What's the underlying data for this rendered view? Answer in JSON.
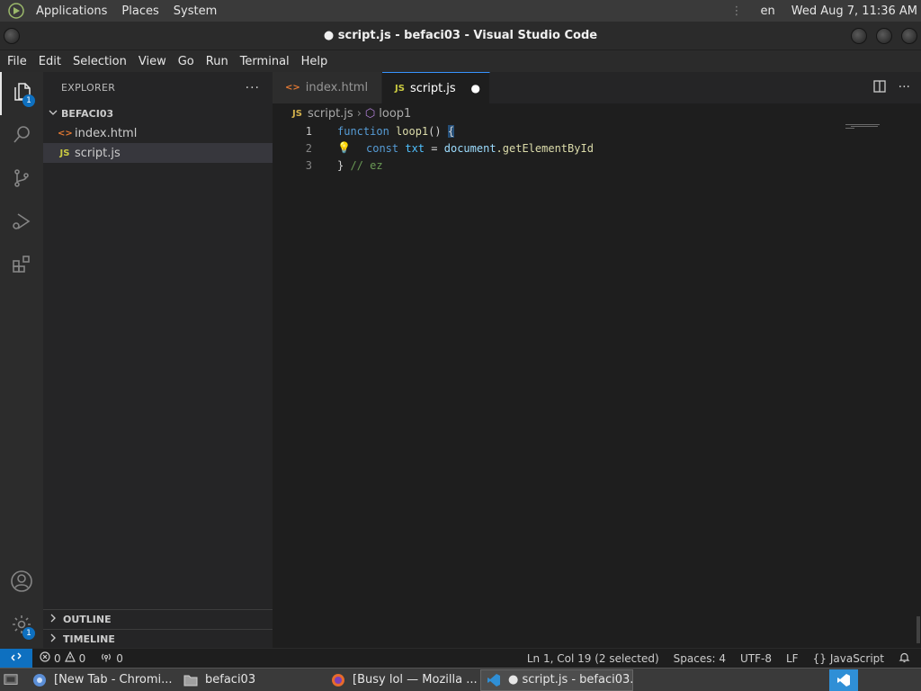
{
  "system_panel": {
    "menus": [
      "Applications",
      "Places",
      "System"
    ],
    "separator": "⋮",
    "language": "en",
    "clock": "Wed Aug 7, 11:36 AM"
  },
  "window": {
    "title": "● script.js - befaci03 - Visual Studio Code"
  },
  "menubar": [
    "File",
    "Edit",
    "Selection",
    "View",
    "Go",
    "Run",
    "Terminal",
    "Help"
  ],
  "activity": {
    "explorer_badge": "1",
    "manage_badge": "1"
  },
  "sidebar": {
    "title": "EXPLORER",
    "more": "···",
    "folder": "BEFACI03",
    "files": [
      {
        "icon": "<>",
        "name": "index.html",
        "icon_color": "#e37933"
      },
      {
        "icon": "JS",
        "name": "script.js",
        "icon_color": "#cbcb41"
      }
    ],
    "outline": "OUTLINE",
    "timeline": "TIMELINE"
  },
  "tabs": [
    {
      "icon": "<>",
      "label": "index.html",
      "active": false,
      "icon_color": "#e37933"
    },
    {
      "icon": "JS",
      "label": "script.js",
      "active": true,
      "icon_color": "#cbcb41",
      "dirty": "●"
    }
  ],
  "breadcrumb": {
    "file_icon": "JS",
    "file": "script.js",
    "chevron": "›",
    "symbol_icon": "⬡",
    "symbol": "loop1"
  },
  "code": {
    "line_numbers": [
      "1",
      "2",
      "3"
    ],
    "line1": {
      "kw": "function",
      "name": "loop1",
      "paren": "()",
      "brace": "{"
    },
    "line2": {
      "kw": "const",
      "var": "txt",
      "op": "=",
      "obj": "document",
      "method": ".getElementById"
    },
    "line3": {
      "brace": "}",
      "comment": "// ez"
    },
    "lightbulb": "💡"
  },
  "status": {
    "problems_errors": "0",
    "problems_warnings": "0",
    "ports": "0",
    "position": "Ln 1, Col 19 (2 selected)",
    "spaces": "Spaces: 4",
    "encoding": "UTF-8",
    "eol": "LF",
    "language_icon": "{}",
    "language": "JavaScript"
  },
  "taskbar": [
    {
      "label": "[New Tab - Chromi...",
      "active": false
    },
    {
      "label": "befaci03",
      "active": false
    },
    {
      "label": "[Busy lol — Mozilla ...",
      "active": false
    },
    {
      "label": "● script.js - befaci03...",
      "active": true
    }
  ]
}
